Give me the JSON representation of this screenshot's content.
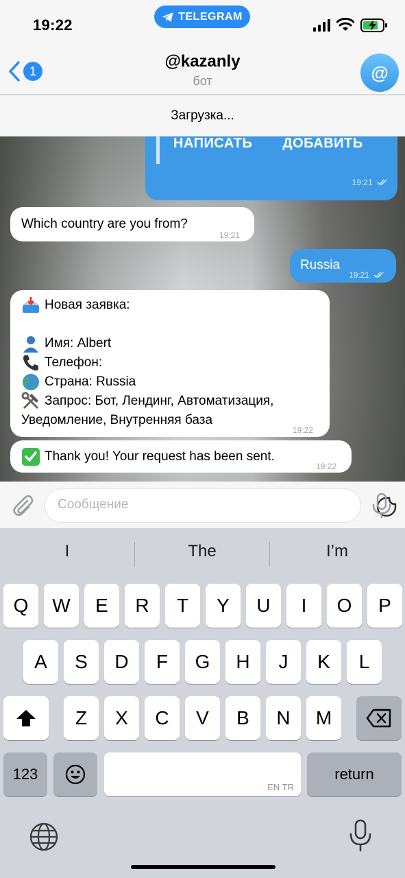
{
  "status_bar": {
    "time": "19:22",
    "app_pill": "TELEGRAM"
  },
  "header": {
    "back_badge": "1",
    "title": "@kazanly",
    "subtitle": "бот",
    "avatar_char": "@"
  },
  "loading_text": "Загрузка...",
  "messages": {
    "inline_keyboard": {
      "btn1": "НАПИСАТЬ",
      "btn2": "ДОБАВИТЬ",
      "time": "19:21"
    },
    "question": {
      "text": "Which country are you from?",
      "time": "19:21"
    },
    "answer": {
      "text": "Russia",
      "time": "19:21"
    },
    "order": {
      "title": "Новая заявка:",
      "name": "Имя: Albert",
      "phone": "Телефон:",
      "country": "Страна: Russia",
      "request_line1": "Запрос: Бот, Лендинг, Автоматизация,",
      "request_line2": "Уведомление, Внутренняя база",
      "time": "19:22"
    },
    "confirm": {
      "text": "Thank you! Your request has been sent.",
      "time": "19:22"
    }
  },
  "input": {
    "placeholder": "Сообщение",
    "value": ""
  },
  "keyboard": {
    "suggestions": [
      "I",
      "The",
      "I’m"
    ],
    "row1": [
      "Q",
      "W",
      "E",
      "R",
      "T",
      "Y",
      "U",
      "I",
      "O",
      "P"
    ],
    "row2": [
      "A",
      "S",
      "D",
      "F",
      "G",
      "H",
      "J",
      "K",
      "L"
    ],
    "row3": [
      "Z",
      "X",
      "C",
      "V",
      "B",
      "N",
      "M"
    ],
    "numbers_key": "123",
    "return_key": "return",
    "space_langs": "EN TR"
  },
  "colors": {
    "accent": "#2a8cf3",
    "outgoing_bubble": "#3e9ae6"
  }
}
